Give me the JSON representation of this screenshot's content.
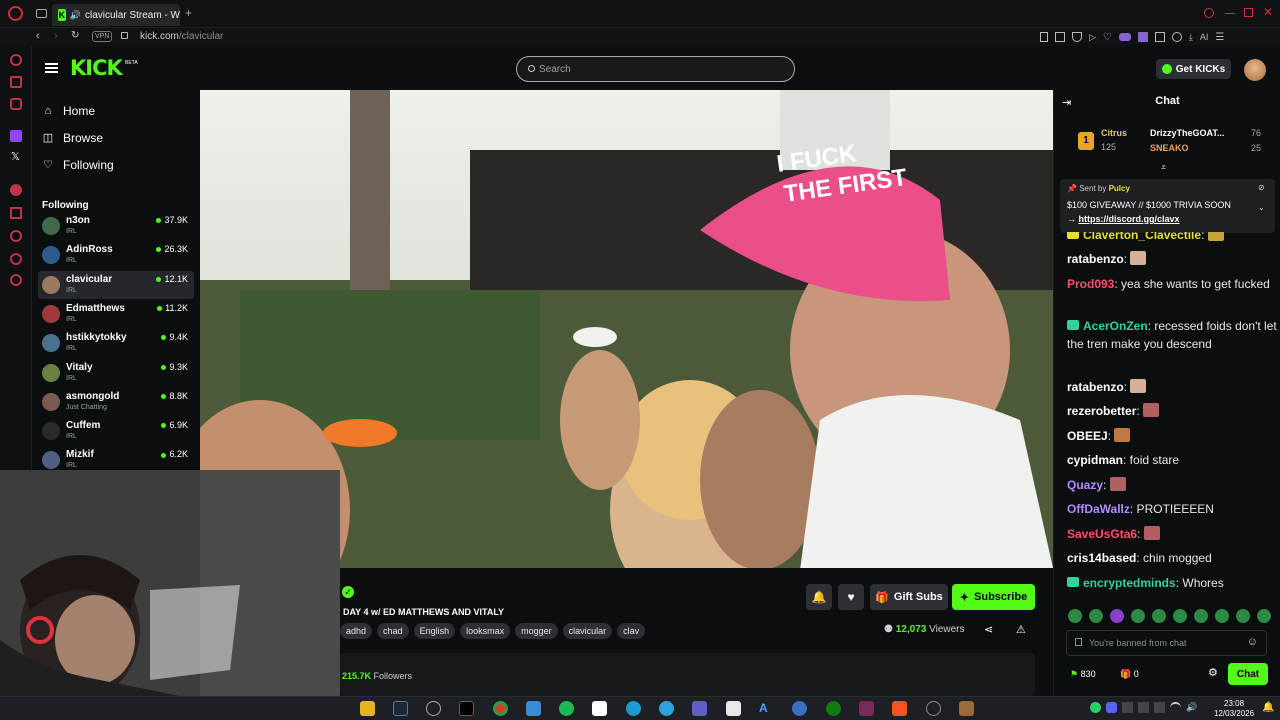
{
  "browser": {
    "tab_title": "clavicular Stream - W",
    "vpn_label": "VPN",
    "url_host": "kick.com",
    "url_path": "/clavicular"
  },
  "header": {
    "logo_text": "KICK",
    "beta_label": "BETA",
    "search_placeholder": "Search",
    "get_kicks_label": "Get KICKs"
  },
  "nav": {
    "home": "Home",
    "browse": "Browse",
    "following": "Following"
  },
  "following_section": {
    "heading": "Following",
    "channels": [
      {
        "name": "n3on",
        "category": "IRL",
        "viewers": "37.9K",
        "color": "#3f6b4a"
      },
      {
        "name": "AdinRoss",
        "category": "IRL",
        "viewers": "26.3K",
        "color": "#2d5c8a"
      },
      {
        "name": "clavicular",
        "category": "IRL",
        "viewers": "12.1K",
        "color": "#9a7a60"
      },
      {
        "name": "Edmatthews",
        "category": "IRL",
        "viewers": "11.2K",
        "color": "#a03a3a"
      },
      {
        "name": "hstikkytokky",
        "category": "IRL",
        "viewers": "9.4K",
        "color": "#4a7090"
      },
      {
        "name": "Vitaly",
        "category": "IRL",
        "viewers": "9.3K",
        "color": "#6a8040"
      },
      {
        "name": "asmongold",
        "category": "Just Chatting",
        "viewers": "8.8K",
        "color": "#7a5a50"
      },
      {
        "name": "Cuffem",
        "category": "IRL",
        "viewers": "6.9K",
        "color": "#2a2a2a"
      },
      {
        "name": "Mizkif",
        "category": "IRL",
        "viewers": "6.2K",
        "color": "#506080"
      }
    ]
  },
  "stream": {
    "title": "DAY 4 w/ ED MATTHEWS AND VITALY",
    "tags": [
      "adhd",
      "chad",
      "English",
      "looksmax",
      "mogger",
      "clavicular",
      "clav"
    ],
    "gift_subs_label": "Gift Subs",
    "subscribe_label": "Subscribe",
    "viewer_count": "12,073",
    "viewers_label": "Viewers",
    "followers_count": "215.7K",
    "followers_label": "Followers"
  },
  "chat": {
    "title": "Chat",
    "leaderboard": [
      {
        "rank": "1",
        "name": "Citrus",
        "value": "125"
      },
      {
        "name": "DrizzyTheGOAT...",
        "value": "76"
      },
      {
        "name": "SNEAKO",
        "value": "25"
      }
    ],
    "pinned": {
      "sent_by_label": "Sent by",
      "sender": "Pulcy",
      "text": "$100 GIVEAWAY // $1000 TRIVIA SOON",
      "link": "https://discord.gg/clavx"
    },
    "messages": [
      {
        "user": "Claverton_Clavectile",
        "color": "#e6e02a",
        "text": ":"
      },
      {
        "user": "ratabenzo",
        "color": "#ffffff",
        "text": ":"
      },
      {
        "user": "Prod093",
        "color": "#ff4f6d",
        "text": ": yea she wants to get fucked"
      },
      {
        "user": "AcerOnZen",
        "color": "#2ed39b",
        "text": ": recessed foids don't let the tren make you descend"
      },
      {
        "user": "ratabenzo",
        "color": "#ffffff",
        "text": ":"
      },
      {
        "user": "rezerobetter",
        "color": "#ffffff",
        "text": ":"
      },
      {
        "user": "OBEEJ",
        "color": "#ffffff",
        "text": ":"
      },
      {
        "user": "cypidman",
        "color": "#ffffff",
        "text": ": foid stare"
      },
      {
        "user": "Quazy",
        "color": "#b58cff",
        "text": ":"
      },
      {
        "user": "OffDaWallz",
        "color": "#b58cff",
        "text": ": PROTIEEEEN"
      },
      {
        "user": "SaveUsGta6",
        "color": "#ff4f6d",
        "text": ":"
      },
      {
        "user": "cris14based",
        "color": "#ffffff",
        "text": ": chin mogged"
      },
      {
        "user": "encryptedminds",
        "color": "#2ed39b",
        "text": ": Whores"
      }
    ],
    "banned_text": "You're banned from chat",
    "points": "830",
    "gifts": "0",
    "chat_button": "Chat"
  },
  "taskbar": {
    "time": "23:08",
    "date": "12/03/2026"
  },
  "colors": {
    "accent": "#53fc18",
    "background": "#0b0e0f",
    "panel": "#2c2f33"
  }
}
